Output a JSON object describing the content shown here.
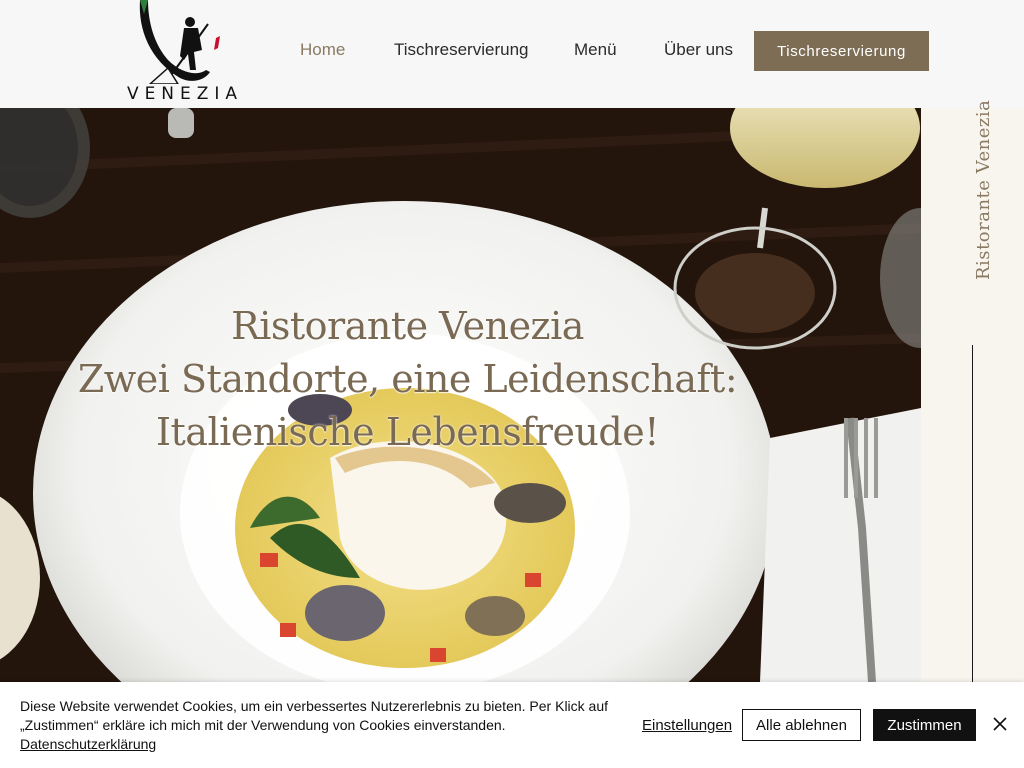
{
  "logo": {
    "text": "VENEZIA",
    "icon": "gondolier-icon"
  },
  "nav": {
    "items": [
      {
        "label": "Home",
        "active": true
      },
      {
        "label": "Tischreservierung",
        "active": false
      },
      {
        "label": "Menü",
        "active": false
      },
      {
        "label": "Über uns",
        "active": false
      }
    ],
    "cta_label": "Tischreservierung"
  },
  "hero": {
    "line1": "Ristorante Venezia",
    "line2": "Zwei Standorte, eine Leidenschaft:",
    "line3": "Italienische Lebensfreude!"
  },
  "side_panel": {
    "label": "Ristorante Venezia"
  },
  "cookie": {
    "text": "Diese Website verwendet Cookies, um ein verbessertes Nutzererlebnis zu bieten. Per Klick auf „Zustimmen“ erkläre ich mich mit der Verwendung von Cookies einverstanden.",
    "privacy_link": "Datenschutzerklärung",
    "settings_label": "Einstellungen",
    "reject_label": "Alle ablehnen",
    "accept_label": "Zustimmen",
    "close_icon": "close-icon"
  },
  "colors": {
    "accent": "#7d6d55",
    "active_nav": "#8a7a63",
    "header_bg": "#f7f7f7",
    "side_bg": "#f8f5ef"
  }
}
